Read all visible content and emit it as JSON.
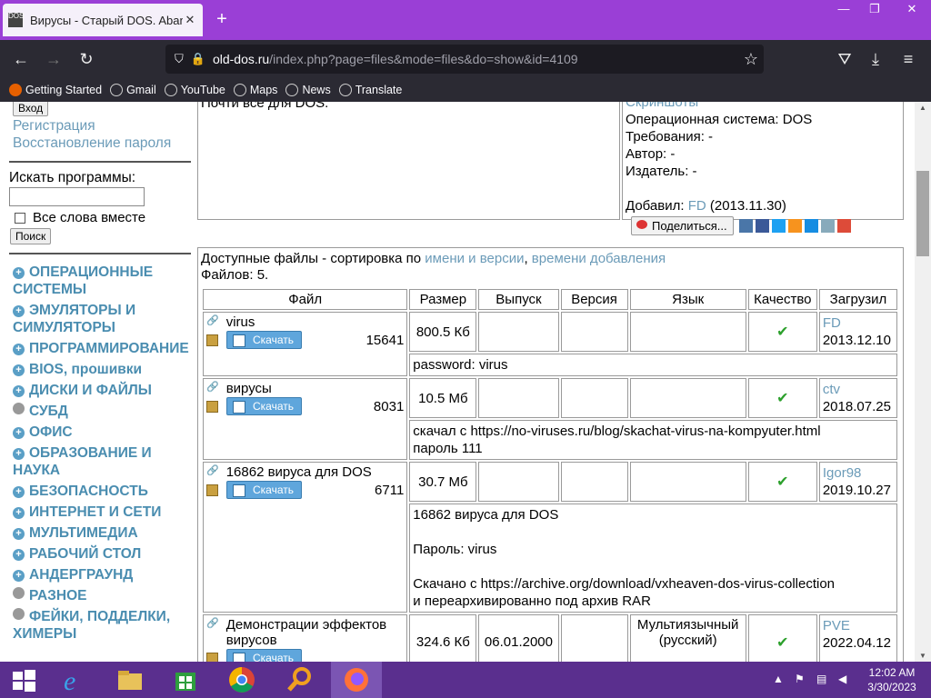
{
  "browser": {
    "tab_title": "Вирусы - Старый DOS. Aband",
    "url_domain": "old-dos.ru",
    "url_rest": "/index.php?page=files&mode=files&do=show&id=4109",
    "bookmarks": [
      "Getting Started",
      "Gmail",
      "YouTube",
      "Maps",
      "News",
      "Translate"
    ]
  },
  "sidebar": {
    "login_btn": "Вход",
    "register": "Регистрация",
    "restore": "Восстановление пароля",
    "search_label": "Искать программы:",
    "search_value": "",
    "all_words": "Все слова вместе",
    "search_btn": "Поиск",
    "categories": [
      {
        "label": "ОПЕРАЦИОННЫЕ СИСТЕМЫ",
        "icon": "plus"
      },
      {
        "label": "ЭМУЛЯТОРЫ И СИМУЛЯТОРЫ",
        "icon": "plus"
      },
      {
        "label": "ПРОГРАММИРОВАНИЕ",
        "icon": "plus"
      },
      {
        "label": "BIOS, прошивки",
        "icon": "plus"
      },
      {
        "label": "ДИСКИ И ФАЙЛЫ",
        "icon": "plus"
      },
      {
        "label": "СУБД",
        "icon": "dot"
      },
      {
        "label": "ОФИС",
        "icon": "plus"
      },
      {
        "label": "ОБРАЗОВАНИЕ И НАУКА",
        "icon": "plus"
      },
      {
        "label": "БЕЗОПАСНОСТЬ",
        "icon": "plus"
      },
      {
        "label": "ИНТЕРНЕТ И СЕТИ",
        "icon": "plus"
      },
      {
        "label": "МУЛЬТИМЕДИА",
        "icon": "plus"
      },
      {
        "label": "РАБОЧИЙ СТОЛ",
        "icon": "plus"
      },
      {
        "label": "АНДЕРГРАУНД",
        "icon": "plus"
      },
      {
        "label": "РАЗНОЕ",
        "icon": "dot"
      },
      {
        "label": "ФЕЙКИ, ПОДДЕЛКИ, ХИМЕРЫ",
        "icon": "dot"
      }
    ]
  },
  "info": {
    "desc": "Почти все для DOS.",
    "screens": "Скриншоты",
    "os": "Операционная система: DOS",
    "req": "Требования: -",
    "author": "Автор: -",
    "publisher": "Издатель: -",
    "added_label": "Добавил:",
    "added_user": "FD",
    "added_date": "(2013.11.30)",
    "share_btn": "Поделиться..."
  },
  "files": {
    "sort_prefix": "Доступные файлы - сортировка по",
    "sort_name": "имени и версии",
    "sort_time": "времени добавления",
    "count": "Файлов: 5.",
    "headers": [
      "Файл",
      "Размер",
      "Выпуск",
      "Версия",
      "Язык",
      "Качество",
      "Загрузил"
    ],
    "download": "Скачать",
    "rows": [
      {
        "name": "virus",
        "downloads": "15641",
        "size": "800.5 Кб",
        "release": "",
        "version": "",
        "lang": "",
        "user": "FD",
        "date": "2013.12.10",
        "note": [
          "password: virus"
        ]
      },
      {
        "name": "вирусы",
        "downloads": "8031",
        "size": "10.5 Мб",
        "release": "",
        "version": "",
        "lang": "",
        "user": "ctv",
        "date": "2018.07.25",
        "note": [
          "скачал с https://no-viruses.ru/blog/skachat-virus-na-kompyuter.html",
          "пароль 111"
        ]
      },
      {
        "name": "16862 вируса для DOS",
        "downloads": "6711",
        "size": "30.7 Мб",
        "release": "",
        "version": "",
        "lang": "",
        "user": "Igor98",
        "date": "2019.10.27",
        "note": [
          "16862 вируса для DOS",
          "",
          "Пароль: virus",
          "",
          "Скачано с https://archive.org/download/vxheaven-dos-virus-collection",
          "и переархивированно под архив RAR"
        ]
      },
      {
        "name": "Демонстрации эффектов вирусов",
        "downloads": "",
        "size": "324.6 Кб",
        "release": "06.01.2000",
        "version": "",
        "lang": "Мультиязычный (русский)",
        "user": "PVE",
        "date": "2022.04.12",
        "note": []
      }
    ]
  },
  "clock": {
    "time": "12:02 AM",
    "date": "3/30/2023"
  }
}
